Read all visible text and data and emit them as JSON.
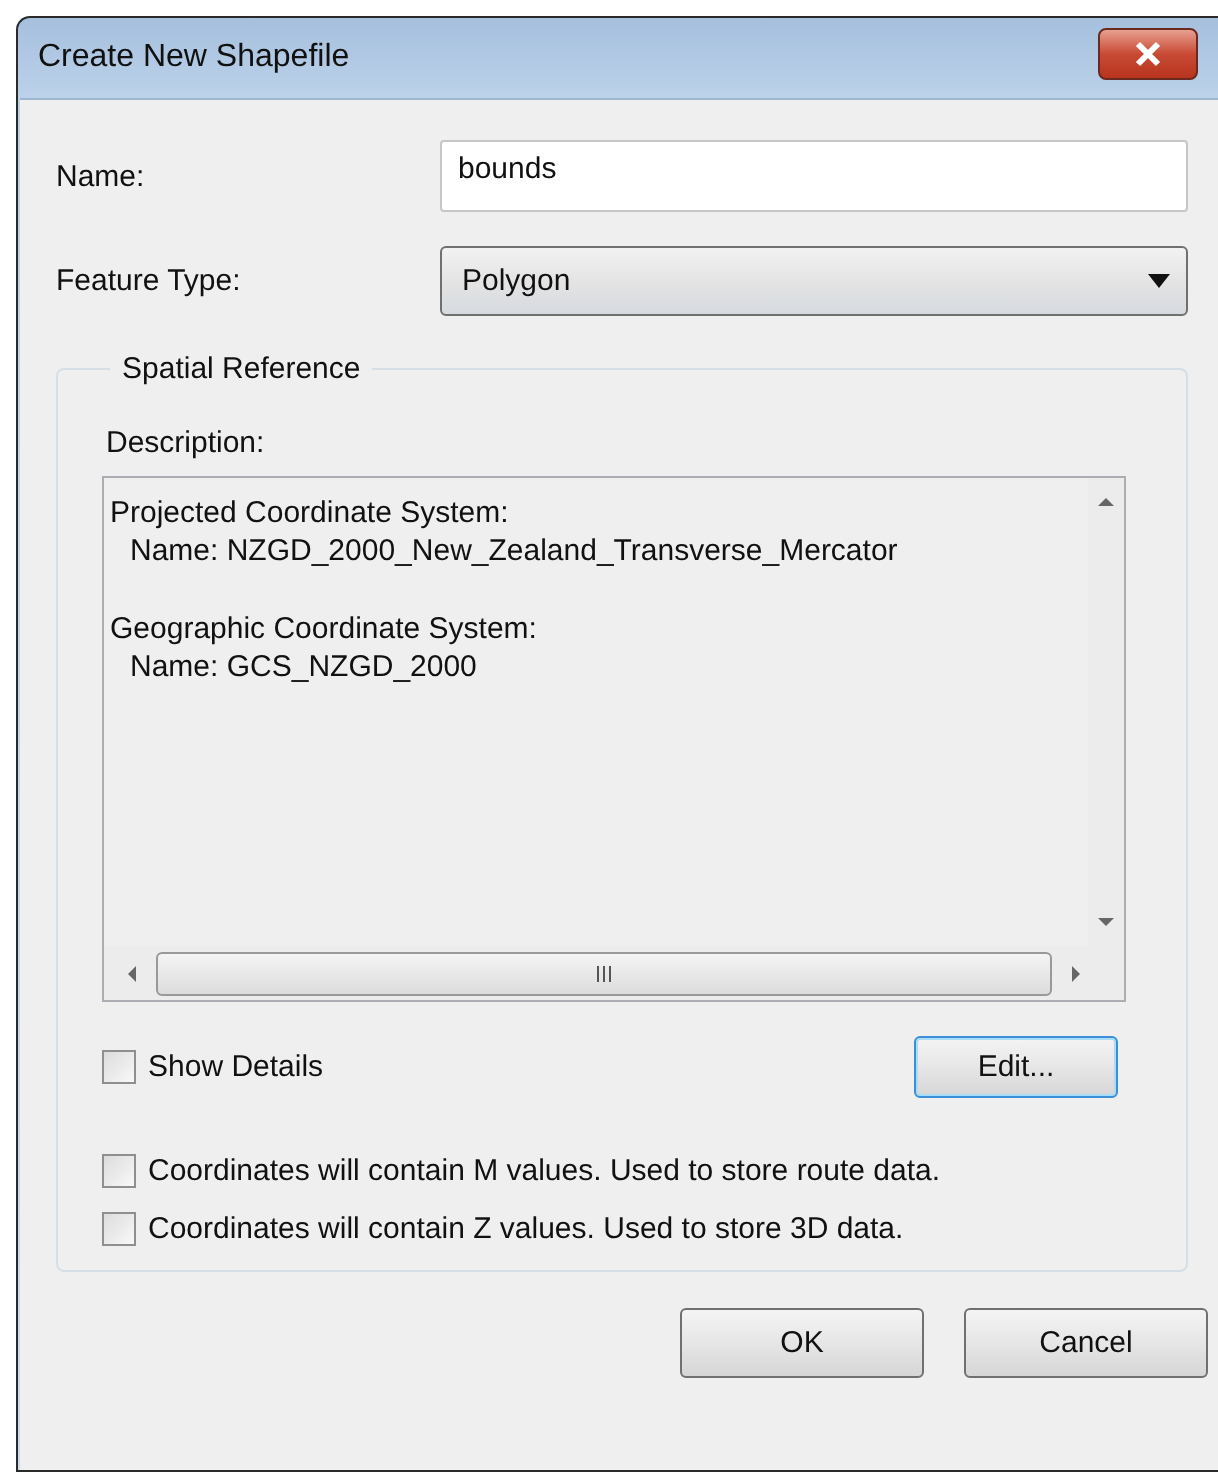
{
  "window": {
    "title": "Create New Shapefile"
  },
  "name_field": {
    "label": "Name:",
    "value": "bounds"
  },
  "feature_type": {
    "label": "Feature Type:",
    "value": "Polygon"
  },
  "spatial_reference": {
    "title": "Spatial Reference",
    "description_label": "Description:",
    "sections": [
      {
        "title": "Projected Coordinate System:",
        "detail": "Name: NZGD_2000_New_Zealand_Transverse_Mercator"
      },
      {
        "title": "Geographic Coordinate System:",
        "detail": "Name: GCS_NZGD_2000"
      }
    ],
    "show_details": {
      "label": "Show Details",
      "checked": false
    },
    "edit_button": {
      "label": "Edit...",
      "focused": true
    },
    "options": [
      {
        "label": "Coordinates will contain M values. Used to store route data.",
        "checked": false
      },
      {
        "label": "Coordinates will contain Z values. Used to store 3D data.",
        "checked": false
      }
    ]
  },
  "buttons": [
    {
      "label": "OK",
      "focused": false
    },
    {
      "label": "Cancel",
      "focused": false
    }
  ]
}
